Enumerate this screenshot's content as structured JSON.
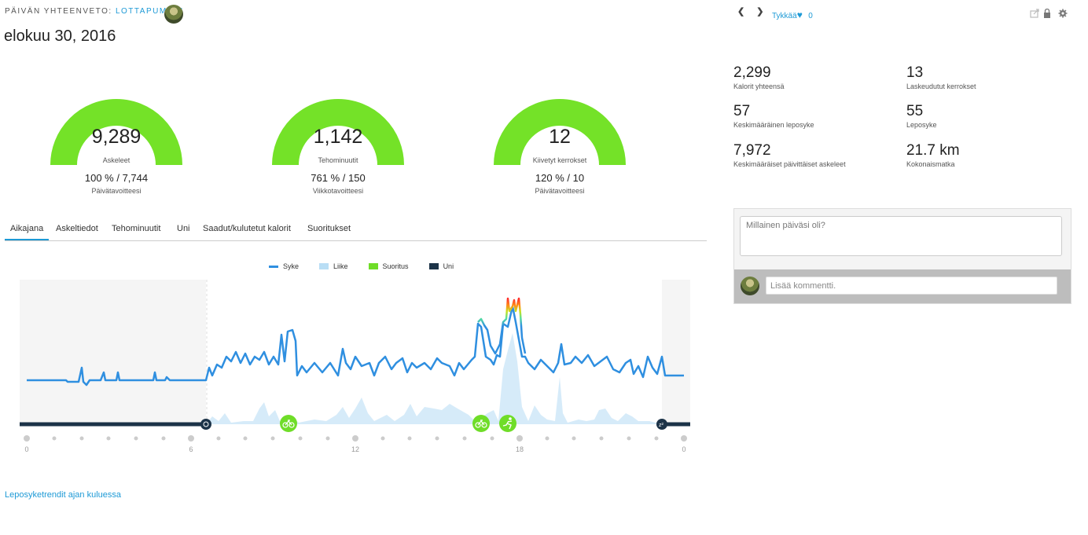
{
  "header": {
    "prefix": "PÄIVÄN YHTEENVETO:",
    "user": "LOTTAPUMPUI",
    "date": "elokuu 30, 2016"
  },
  "gauges": [
    {
      "value": "9,289",
      "label": "Askeleet",
      "goal": "100 % / 7,744",
      "goal_label": "Päivätavoitteesi",
      "percent": 100
    },
    {
      "value": "1,142",
      "label": "Tehominuutit",
      "goal": "761 % / 150",
      "goal_label": "Viikkotavoitteesi",
      "percent": 100
    },
    {
      "value": "12",
      "label": "Kiivetyt kerrokset",
      "goal": "120 % / 10",
      "goal_label": "Päivätavoitteesi",
      "percent": 100
    }
  ],
  "tabs": [
    "Aikajana",
    "Askeltiedot",
    "Tehominuutit",
    "Uni",
    "Saadut/kulutetut kalorit",
    "Suoritukset"
  ],
  "active_tab": "Aikajana",
  "legend": [
    {
      "label": "Syke",
      "color": "#2f8fe0"
    },
    {
      "label": "Liike",
      "color": "#b9def5"
    },
    {
      "label": "Suoritus",
      "color": "#6fdd28"
    },
    {
      "label": "Uni",
      "color": "#1c3348"
    }
  ],
  "axis_ticks": [
    "0",
    "6",
    "12",
    "18",
    "0"
  ],
  "stats": [
    {
      "value": "2,299",
      "label": "Kalorit yhteensä"
    },
    {
      "value": "13",
      "label": "Laskeudutut kerrokset"
    },
    {
      "value": "57",
      "label": "Keskimääräinen leposyke"
    },
    {
      "value": "55",
      "label": "Leposyke"
    },
    {
      "value": "7,972",
      "label": "Keskimääräiset päivittäiset askeleet"
    },
    {
      "value": "21.7 km",
      "label": "Kokonaismatka"
    }
  ],
  "topnav": {
    "like_label": "Tykkää",
    "like_count": "0",
    "icons": [
      "chevron-left-icon",
      "chevron-right-icon",
      "heart-icon",
      "share-icon",
      "lock-icon",
      "gear-icon"
    ]
  },
  "comments": {
    "prompt_placeholder": "Millainen päiväsi oli?",
    "comment_placeholder": "Lisää kommentti."
  },
  "trend_link": "Leposyketrendit ajan kuluessa",
  "colors": {
    "accent": "#1e9ad6",
    "gauge": "#74e228",
    "heart_rate": "#2f8fe0",
    "sleep": "#1c3348"
  },
  "timeline": {
    "activities": [
      {
        "type": "bike",
        "hour": 9.5
      },
      {
        "type": "bike",
        "hour": 16.55
      },
      {
        "type": "run",
        "hour": 17.5
      }
    ],
    "sleep_end_hour": 6.5,
    "sleep_start_hour": 23.4
  }
}
